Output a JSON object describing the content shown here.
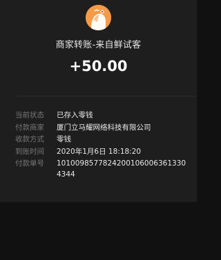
{
  "header": {
    "merchant_title": "商家转账-来自鲜试客",
    "amount": "+50.00"
  },
  "details": [
    {
      "label": "当前状态",
      "value": "已存入零钱"
    },
    {
      "label": "付款商家",
      "value": "厦门立马耀网络科技有限公司"
    },
    {
      "label": "收款方式",
      "value": "零钱"
    },
    {
      "label": "到账时间",
      "value": "2020年1月6日  18:18:20"
    },
    {
      "label": "付款单号",
      "value": "10100985778242001060063613304344"
    }
  ],
  "colors": {
    "background": "#111111",
    "card": "#1e1e1e",
    "avatar": "#f59a47",
    "label": "#777777",
    "value": "#e8e8e8"
  },
  "icons": {
    "avatar": "merchant-logo-icon"
  }
}
